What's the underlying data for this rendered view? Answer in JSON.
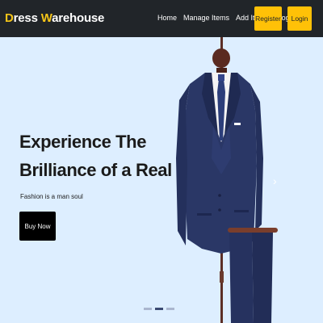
{
  "brand": {
    "first": "D",
    "first_rest": "ress ",
    "second": "W",
    "second_rest": "arehouse"
  },
  "nav": {
    "items": [
      "Home",
      "Manage Items",
      "Add Items",
      "Blogs"
    ],
    "register": "Register",
    "login": "Login"
  },
  "hero": {
    "headline_line1": "Experience The",
    "headline_line2": "Brilliance of a Real Gem",
    "tagline": "Fashion is a man soul",
    "button": "Buy Now"
  },
  "carousel": {
    "next_icon": "chevron-right-icon"
  },
  "colors": {
    "navbar": "#212529",
    "accent": "#ffc107",
    "hero_bg": "#ddeeff",
    "suit": "#2a3766"
  }
}
